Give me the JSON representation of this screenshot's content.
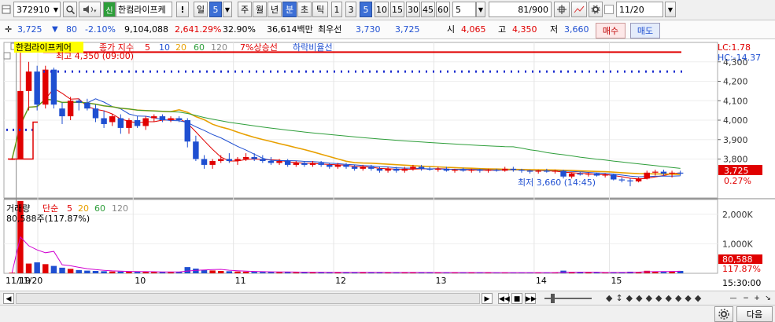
{
  "toolbar": {
    "code": "372910",
    "name": "한컴라이프케",
    "buttons": [
      {
        "label": "!"
      },
      {
        "label": "일"
      },
      {
        "label": "5"
      },
      {
        "label": "주"
      },
      {
        "label": "월"
      },
      {
        "label": "년"
      },
      {
        "label": "분"
      },
      {
        "label": "초"
      },
      {
        "label": "틱"
      },
      {
        "label": "1"
      },
      {
        "label": "3"
      },
      {
        "label": "5"
      },
      {
        "label": "10"
      },
      {
        "label": "15"
      },
      {
        "label": "30"
      },
      {
        "label": "45"
      },
      {
        "label": "60"
      },
      {
        "label": "5"
      }
    ],
    "count": "81",
    "count_total": "/900",
    "date": "11/20",
    "selected_period": "분",
    "selected_min": "5"
  },
  "quote": {
    "price": "3,725",
    "change": "80",
    "change_pct": "-2.10%",
    "volume": "9,104,088",
    "volume_pct": "2,641.29%",
    "turnover_pct": "32.90%",
    "amount": "36,614백만",
    "best_ask_label": "최우선",
    "ask": "3,730",
    "bid": "3,725",
    "open_label": "시",
    "open": "4,065",
    "high_label": "고",
    "high": "4,350",
    "low_label": "저",
    "low": "3,660",
    "buy_button": "매수",
    "sell_button": "매도"
  },
  "price_panel": {
    "name_label": "한컴라이프케어",
    "ma_legend": [
      "종가 지수",
      "5",
      "10",
      "20",
      "60",
      "120"
    ],
    "legend_7pct": "7%상승선",
    "legend_fall": "하락비율선",
    "high_annot": "최고 4,350 (09:00)",
    "low_annot": "최저 3,660 (14:45)",
    "lc": "LC:1.78",
    "hc": "HC:-14.37",
    "y_ticks": [
      "4,300",
      "4,200",
      "4,100",
      "4,000",
      "3,900",
      "3,800"
    ],
    "last_price_tag": "3,725",
    "last_pct_tag": "0.27%"
  },
  "volume_panel": {
    "title": "거래량",
    "ma_legend": [
      "단순",
      "5",
      "20",
      "60",
      "120"
    ],
    "vol_info": "80,588주(117.87%)",
    "y_ticks": [
      "2,000K",
      "1,000K"
    ],
    "last_vol_tag": "80,588",
    "last_pct_tag": "117.87%"
  },
  "x_axis": {
    "labels": [
      "11/19",
      "11/20",
      "10",
      "11",
      "12",
      "13",
      "14",
      "15"
    ],
    "time_label": "15:30:00"
  },
  "bottom": {
    "next_button": "다음"
  },
  "chart_data": {
    "type": "candlestick",
    "interval": "5분",
    "candles": [
      {
        "o": 3800,
        "h": 3805,
        "l": 3795,
        "c": 3800
      },
      {
        "o": 3800,
        "h": 4350,
        "l": 3800,
        "c": 4150
      },
      {
        "o": 4150,
        "h": 4300,
        "l": 4050,
        "c": 4250
      },
      {
        "o": 4250,
        "h": 4280,
        "l": 4050,
        "c": 4080
      },
      {
        "o": 4080,
        "h": 4280,
        "l": 4060,
        "c": 4260
      },
      {
        "o": 4260,
        "h": 4270,
        "l": 4060,
        "c": 4080
      },
      {
        "o": 4060,
        "h": 4090,
        "l": 3980,
        "c": 4020
      },
      {
        "o": 4020,
        "h": 4120,
        "l": 4000,
        "c": 4100
      },
      {
        "o": 4100,
        "h": 4110,
        "l": 4050,
        "c": 4090
      },
      {
        "o": 4090,
        "h": 4110,
        "l": 4050,
        "c": 4060
      },
      {
        "o": 4060,
        "h": 4080,
        "l": 3990,
        "c": 4010
      },
      {
        "o": 4010,
        "h": 4050,
        "l": 3960,
        "c": 3980
      },
      {
        "o": 3990,
        "h": 4030,
        "l": 3970,
        "c": 4020
      },
      {
        "o": 4010,
        "h": 4030,
        "l": 3930,
        "c": 3960
      },
      {
        "o": 3960,
        "h": 4010,
        "l": 3930,
        "c": 4000
      },
      {
        "o": 4000,
        "h": 4020,
        "l": 3960,
        "c": 3970
      },
      {
        "o": 3970,
        "h": 4020,
        "l": 3950,
        "c": 4010
      },
      {
        "o": 4010,
        "h": 4030,
        "l": 3990,
        "c": 4020
      },
      {
        "o": 4020,
        "h": 4030,
        "l": 3990,
        "c": 4000
      },
      {
        "o": 4000,
        "h": 4020,
        "l": 3990,
        "c": 4010
      },
      {
        "o": 4010,
        "h": 4020,
        "l": 3990,
        "c": 4000
      },
      {
        "o": 4000,
        "h": 4010,
        "l": 3860,
        "c": 3890
      },
      {
        "o": 3890,
        "h": 3920,
        "l": 3790,
        "c": 3800
      },
      {
        "o": 3800,
        "h": 3820,
        "l": 3750,
        "c": 3770
      },
      {
        "o": 3770,
        "h": 3800,
        "l": 3750,
        "c": 3790
      },
      {
        "o": 3790,
        "h": 3820,
        "l": 3780,
        "c": 3800
      },
      {
        "o": 3800,
        "h": 3830,
        "l": 3780,
        "c": 3790
      },
      {
        "o": 3790,
        "h": 3810,
        "l": 3770,
        "c": 3800
      },
      {
        "o": 3800,
        "h": 3830,
        "l": 3790,
        "c": 3810
      },
      {
        "o": 3810,
        "h": 3830,
        "l": 3790,
        "c": 3800
      },
      {
        "o": 3800,
        "h": 3820,
        "l": 3780,
        "c": 3790
      },
      {
        "o": 3790,
        "h": 3810,
        "l": 3770,
        "c": 3780
      },
      {
        "o": 3780,
        "h": 3800,
        "l": 3770,
        "c": 3790
      },
      {
        "o": 3790,
        "h": 3800,
        "l": 3760,
        "c": 3770
      },
      {
        "o": 3770,
        "h": 3790,
        "l": 3760,
        "c": 3780
      },
      {
        "o": 3780,
        "h": 3790,
        "l": 3760,
        "c": 3770
      },
      {
        "o": 3770,
        "h": 3790,
        "l": 3760,
        "c": 3780
      },
      {
        "o": 3780,
        "h": 3790,
        "l": 3760,
        "c": 3770
      },
      {
        "o": 3770,
        "h": 3780,
        "l": 3750,
        "c": 3760
      },
      {
        "o": 3760,
        "h": 3780,
        "l": 3750,
        "c": 3770
      },
      {
        "o": 3770,
        "h": 3780,
        "l": 3750,
        "c": 3760
      },
      {
        "o": 3760,
        "h": 3770,
        "l": 3740,
        "c": 3750
      },
      {
        "o": 3750,
        "h": 3770,
        "l": 3740,
        "c": 3760
      },
      {
        "o": 3760,
        "h": 3770,
        "l": 3740,
        "c": 3750
      },
      {
        "o": 3750,
        "h": 3760,
        "l": 3730,
        "c": 3740
      },
      {
        "o": 3740,
        "h": 3760,
        "l": 3730,
        "c": 3750
      },
      {
        "o": 3750,
        "h": 3760,
        "l": 3730,
        "c": 3740
      },
      {
        "o": 3740,
        "h": 3760,
        "l": 3730,
        "c": 3750
      },
      {
        "o": 3750,
        "h": 3770,
        "l": 3740,
        "c": 3760
      },
      {
        "o": 3760,
        "h": 3770,
        "l": 3740,
        "c": 3750
      },
      {
        "o": 3750,
        "h": 3760,
        "l": 3740,
        "c": 3745
      },
      {
        "o": 3745,
        "h": 3760,
        "l": 3735,
        "c": 3750
      },
      {
        "o": 3750,
        "h": 3760,
        "l": 3735,
        "c": 3740
      },
      {
        "o": 3740,
        "h": 3750,
        "l": 3730,
        "c": 3745
      },
      {
        "o": 3745,
        "h": 3755,
        "l": 3735,
        "c": 3740
      },
      {
        "o": 3740,
        "h": 3750,
        "l": 3730,
        "c": 3745
      },
      {
        "o": 3745,
        "h": 3750,
        "l": 3730,
        "c": 3740
      },
      {
        "o": 3740,
        "h": 3750,
        "l": 3730,
        "c": 3745
      },
      {
        "o": 3745,
        "h": 3750,
        "l": 3735,
        "c": 3740
      },
      {
        "o": 3740,
        "h": 3760,
        "l": 3735,
        "c": 3750
      },
      {
        "o": 3750,
        "h": 3760,
        "l": 3735,
        "c": 3745
      },
      {
        "o": 3745,
        "h": 3750,
        "l": 3730,
        "c": 3740
      },
      {
        "o": 3740,
        "h": 3745,
        "l": 3725,
        "c": 3735
      },
      {
        "o": 3735,
        "h": 3745,
        "l": 3725,
        "c": 3740
      },
      {
        "o": 3740,
        "h": 3750,
        "l": 3730,
        "c": 3735
      },
      {
        "o": 3735,
        "h": 3745,
        "l": 3725,
        "c": 3740
      },
      {
        "o": 3740,
        "h": 3745,
        "l": 3700,
        "c": 3710
      },
      {
        "o": 3710,
        "h": 3730,
        "l": 3700,
        "c": 3725
      },
      {
        "o": 3725,
        "h": 3735,
        "l": 3715,
        "c": 3720
      },
      {
        "o": 3720,
        "h": 3730,
        "l": 3710,
        "c": 3725
      },
      {
        "o": 3725,
        "h": 3730,
        "l": 3710,
        "c": 3715
      },
      {
        "o": 3715,
        "h": 3725,
        "l": 3705,
        "c": 3720
      },
      {
        "o": 3720,
        "h": 3725,
        "l": 3690,
        "c": 3695
      },
      {
        "o": 3695,
        "h": 3705,
        "l": 3680,
        "c": 3690
      },
      {
        "o": 3690,
        "h": 3700,
        "l": 3660,
        "c": 3685
      },
      {
        "o": 3685,
        "h": 3705,
        "l": 3680,
        "c": 3700
      },
      {
        "o": 3700,
        "h": 3740,
        "l": 3695,
        "c": 3730
      },
      {
        "o": 3730,
        "h": 3745,
        "l": 3715,
        "c": 3735
      },
      {
        "o": 3735,
        "h": 3745,
        "l": 3715,
        "c": 3725
      },
      {
        "o": 3725,
        "h": 3740,
        "l": 3705,
        "c": 3730
      },
      {
        "o": 3730,
        "h": 3740,
        "l": 3715,
        "c": 3725
      }
    ],
    "volumes": [
      20,
      2450,
      330,
      370,
      310,
      250,
      190,
      150,
      110,
      90,
      80,
      70,
      60,
      60,
      55,
      50,
      50,
      45,
      45,
      40,
      40,
      210,
      160,
      120,
      95,
      80,
      70,
      60,
      55,
      50,
      45,
      45,
      40,
      40,
      38,
      36,
      35,
      34,
      33,
      32,
      32,
      31,
      30,
      30,
      30,
      29,
      29,
      28,
      28,
      28,
      27,
      27,
      26,
      26,
      26,
      25,
      25,
      25,
      24,
      24,
      24,
      24,
      23,
      23,
      23,
      23,
      90,
      30,
      28,
      26,
      25,
      24,
      40,
      35,
      55,
      45,
      85,
      60,
      50,
      70,
      81
    ],
    "y_range": [
      3600,
      4400
    ],
    "volume_range": [
      0,
      2500
    ],
    "resistance_dotted": 4250,
    "support_dotted": 3950,
    "red_line": 4350
  }
}
